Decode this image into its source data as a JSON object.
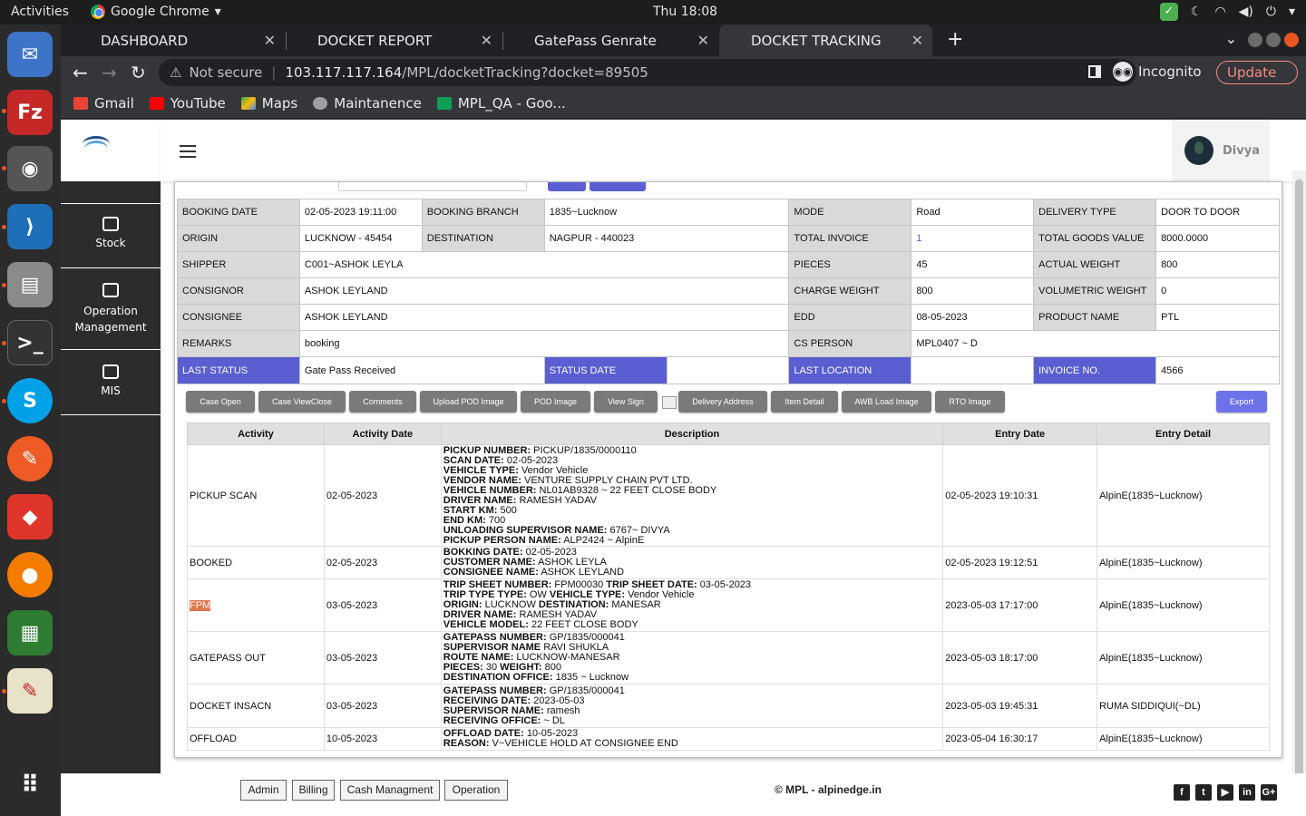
{
  "topbar": {
    "activities": "Activities",
    "app_name": "Google Chrome",
    "clock": "Thu 18:08"
  },
  "dock": {
    "items": [
      "thunderbird-icon",
      "filezilla-icon",
      "chrome-icon",
      "vscode-icon",
      "files-icon",
      "terminal-icon",
      "skype-icon",
      "postman-icon",
      "anydesk-icon",
      "firefox-icon",
      "libreoffice-calc-icon",
      "text-editor-icon",
      "app-grid-icon"
    ]
  },
  "browser": {
    "tabs": [
      {
        "title": "DASHBOARD"
      },
      {
        "title": "DOCKET REPORT"
      },
      {
        "title": "GatePass Genrate"
      },
      {
        "title": "DOCKET TRACKING"
      }
    ],
    "security": "Not secure",
    "url_host": "103.117.117.164",
    "url_path": "/MPL/docketTracking?docket=89505",
    "incognito": "Incognito",
    "update": "Update",
    "bookmarks": [
      "Gmail",
      "YouTube",
      "Maps",
      "Maintanence",
      "MPL_QA - Goo..."
    ]
  },
  "sidebar": {
    "items": [
      {
        "label": "Stock"
      },
      {
        "label": "Operation Management"
      },
      {
        "label": "MIS"
      }
    ]
  },
  "user": {
    "name": "Divya"
  },
  "info": {
    "row1": [
      "BOOKING DATE",
      "02-05-2023 19:11:00",
      "BOOKING BRANCH",
      "1835~Lucknow",
      "MODE",
      "Road",
      "DELIVERY TYPE",
      "DOOR TO DOOR"
    ],
    "row2": [
      "ORIGIN",
      "LUCKNOW - 45454",
      "DESTINATION",
      "NAGPUR - 440023",
      "TOTAL INVOICE",
      "1",
      "TOTAL GOODS VALUE",
      "8000.0000"
    ],
    "row3": [
      "SHIPPER",
      "C001~ASHOK LEYLA",
      "PIECES",
      "45",
      "ACTUAL WEIGHT",
      "800"
    ],
    "row4": [
      "CONSIGNOR",
      "ASHOK LEYLAND",
      "CHARGE WEIGHT",
      "800",
      "VOLUMETRIC WEIGHT",
      "0"
    ],
    "row5": [
      "CONSIGNEE",
      "ASHOK LEYLAND",
      "EDD",
      "08-05-2023",
      "PRODUCT NAME",
      "PTL"
    ],
    "row6": [
      "REMARKS",
      "booking",
      "CS PERSON",
      "MPL0407 ~ D"
    ],
    "row7": [
      "LAST STATUS",
      "Gate Pass Received",
      "STATUS DATE",
      "",
      "LAST LOCATION",
      "",
      "INVOICE NO.",
      "4566"
    ]
  },
  "actions": [
    "Case Open",
    "Case ViewClose",
    "Comments",
    "Upload POD Image",
    "POD Image",
    "View Sign",
    "Delivery Address",
    "Item Detail",
    "AWB Load Image",
    "RTO Image",
    "Export"
  ],
  "track": {
    "headers": [
      "Activity",
      "Activity Date",
      "Description",
      "Entry Date",
      "Entry Detail"
    ],
    "rows": [
      {
        "activity": "PICKUP SCAN",
        "date": "02-05-2023",
        "desc": [
          [
            [
              "PICKUP NUMBER:",
              " PICKUP/1835/0000110"
            ]
          ],
          [
            [
              "SCAN DATE:",
              " 02-05-2023"
            ]
          ],
          [
            [
              "VEHICLE TYPE:",
              " Vendor Vehicle"
            ]
          ],
          [
            [
              "VENDOR NAME:",
              " VENTURE SUPPLY CHAIN PVT LTD."
            ]
          ],
          [
            [
              "VEHICLE NUMBER:",
              " NL01AB9328 ~ 22 FEET CLOSE BODY"
            ]
          ],
          [
            [
              "DRIVER NAME:",
              " RAMESH YADAV"
            ]
          ],
          [
            [
              "START KM:",
              " 500"
            ]
          ],
          [
            [
              "END KM:",
              " 700"
            ]
          ],
          [
            [
              "UNLOADING SUPERVISOR NAME:",
              " 6767~ DIVYA"
            ]
          ],
          [
            [
              "PICKUP PERSON NAME:",
              " ALP2424 ~ AlpinE"
            ]
          ]
        ],
        "entry_date": "02-05-2023 19:10:31",
        "entry_detail": "AlpinE(1835~Lucknow)"
      },
      {
        "activity": "BOOKED",
        "date": "02-05-2023",
        "desc": [
          [
            [
              "BOKKING DATE:",
              " 02-05-2023"
            ]
          ],
          [
            [
              "CUSTOMER NAME:",
              " ASHOK LEYLA"
            ]
          ],
          [
            [
              "CONSIGNEE NAME:",
              " ASHOK LEYLAND"
            ]
          ]
        ],
        "entry_date": "02-05-2023 19:12:51",
        "entry_detail": "AlpinE(1835~Lucknow)"
      },
      {
        "activity": "FPM",
        "date": "03-05-2023",
        "desc": [
          [
            [
              "TRIP SHEET NUMBER:",
              " FPM00030 "
            ],
            [
              "TRIP SHEET DATE:",
              " 03-05-2023"
            ]
          ],
          [
            [
              "TRIP TYPE TYPE:",
              " OW "
            ],
            [
              "VEHICLE TYPE:",
              " Vendor Vehicle"
            ]
          ],
          [
            [
              "ORIGIN:",
              " LUCKNOW "
            ],
            [
              "DESTINATION:",
              " MANESAR"
            ]
          ],
          [
            [
              "DRIVER NAME:",
              " RAMESH YADAV"
            ]
          ],
          [
            [
              "VEHICLE MODEL:",
              " 22 FEET CLOSE BODY"
            ]
          ]
        ],
        "entry_date": "2023-05-03 17:17:00",
        "entry_detail": "AlpinE(1835~Lucknow)"
      },
      {
        "activity": "GATEPASS OUT",
        "date": "03-05-2023",
        "desc": [
          [
            [
              "GATEPASS NUMBER:",
              " GP/1835/000041"
            ]
          ],
          [
            [
              "SUPERVISOR NAME",
              " RAVI SHUKLA"
            ]
          ],
          [
            [
              "ROUTE NAME:",
              " LUCKNOW-MANESAR"
            ]
          ],
          [
            [
              "PIECES:",
              " 30 "
            ],
            [
              "WEIGHT:",
              " 800"
            ]
          ],
          [
            [
              "DESTINATION OFFICE:",
              " 1835 ~ Lucknow"
            ]
          ]
        ],
        "entry_date": "2023-05-03 18:17:00",
        "entry_detail": "AlpinE(1835~Lucknow)"
      },
      {
        "activity": "DOCKET INSACN",
        "date": "03-05-2023",
        "desc": [
          [
            [
              "GATEPASS NUMBER:",
              " GP/1835/000041"
            ]
          ],
          [
            [
              "RECEIVING DATE:",
              " 2023-05-03"
            ]
          ],
          [
            [
              "SUPERVISOR NAME:",
              " ramesh"
            ]
          ],
          [
            [
              "RECEIVING OFFICE:",
              " ~ DL"
            ]
          ]
        ],
        "entry_date": "2023-05-03 19:45:31",
        "entry_detail": "RUMA SIDDIQUI(~DL)"
      },
      {
        "activity": "OFFLOAD",
        "date": "10-05-2023",
        "desc": [
          [
            [
              "OFFLOAD DATE:",
              " 10-05-2023"
            ]
          ],
          [
            [
              "REASON:",
              " V~VEHICLE HOLD AT CONSIGNEE END"
            ]
          ]
        ],
        "entry_date": "2023-05-04 16:30:17",
        "entry_detail": "AlpinE(1835~Lucknow)"
      }
    ]
  },
  "footer": {
    "buttons": [
      "Admin",
      "Billing",
      "Cash Managment",
      "Operation"
    ],
    "copyright": "© MPL - alpinedge.in",
    "social": [
      "facebook-icon",
      "twitter-icon",
      "youtube-icon",
      "linkedin-icon",
      "google-plus-icon"
    ]
  },
  "colors": {
    "highlight_label": "#5a5ed0",
    "export_button": "#6d72e8",
    "fpm_highlight": "#e2754b",
    "sidebar": "#2c2c2c"
  }
}
